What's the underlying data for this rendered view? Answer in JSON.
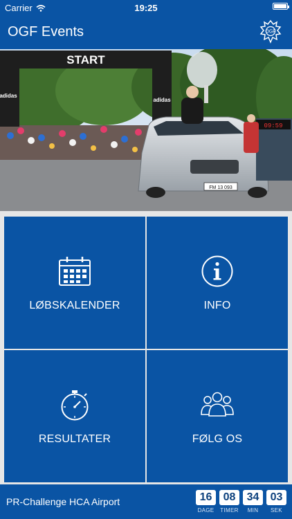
{
  "status_bar": {
    "carrier": "Carrier",
    "time": "19:25",
    "battery_level": 1.0
  },
  "header": {
    "title": "OGF Events",
    "logo_icon": "ogf-crest-icon",
    "logo_text": "OGF"
  },
  "hero": {
    "banner_text": "START",
    "banner_brand": "adidas",
    "car_plate": "FM 13 093"
  },
  "tiles": [
    {
      "label": "LØBSKALENDER",
      "icon": "calendar-icon"
    },
    {
      "label": "INFO",
      "icon": "info-icon"
    },
    {
      "label": "RESULTATER",
      "icon": "stopwatch-icon"
    },
    {
      "label": "FØLG OS",
      "icon": "people-icon"
    }
  ],
  "bottom_bar": {
    "event_name": "PR-Challenge HCA Airport",
    "countdown": [
      {
        "value": "16",
        "label": "DAGE"
      },
      {
        "value": "08",
        "label": "TIMER"
      },
      {
        "value": "34",
        "label": "MIN"
      },
      {
        "value": "03",
        "label": "SEK"
      }
    ]
  },
  "colors": {
    "brand_blue": "#0a54a4",
    "background": "#e6e6e6"
  }
}
